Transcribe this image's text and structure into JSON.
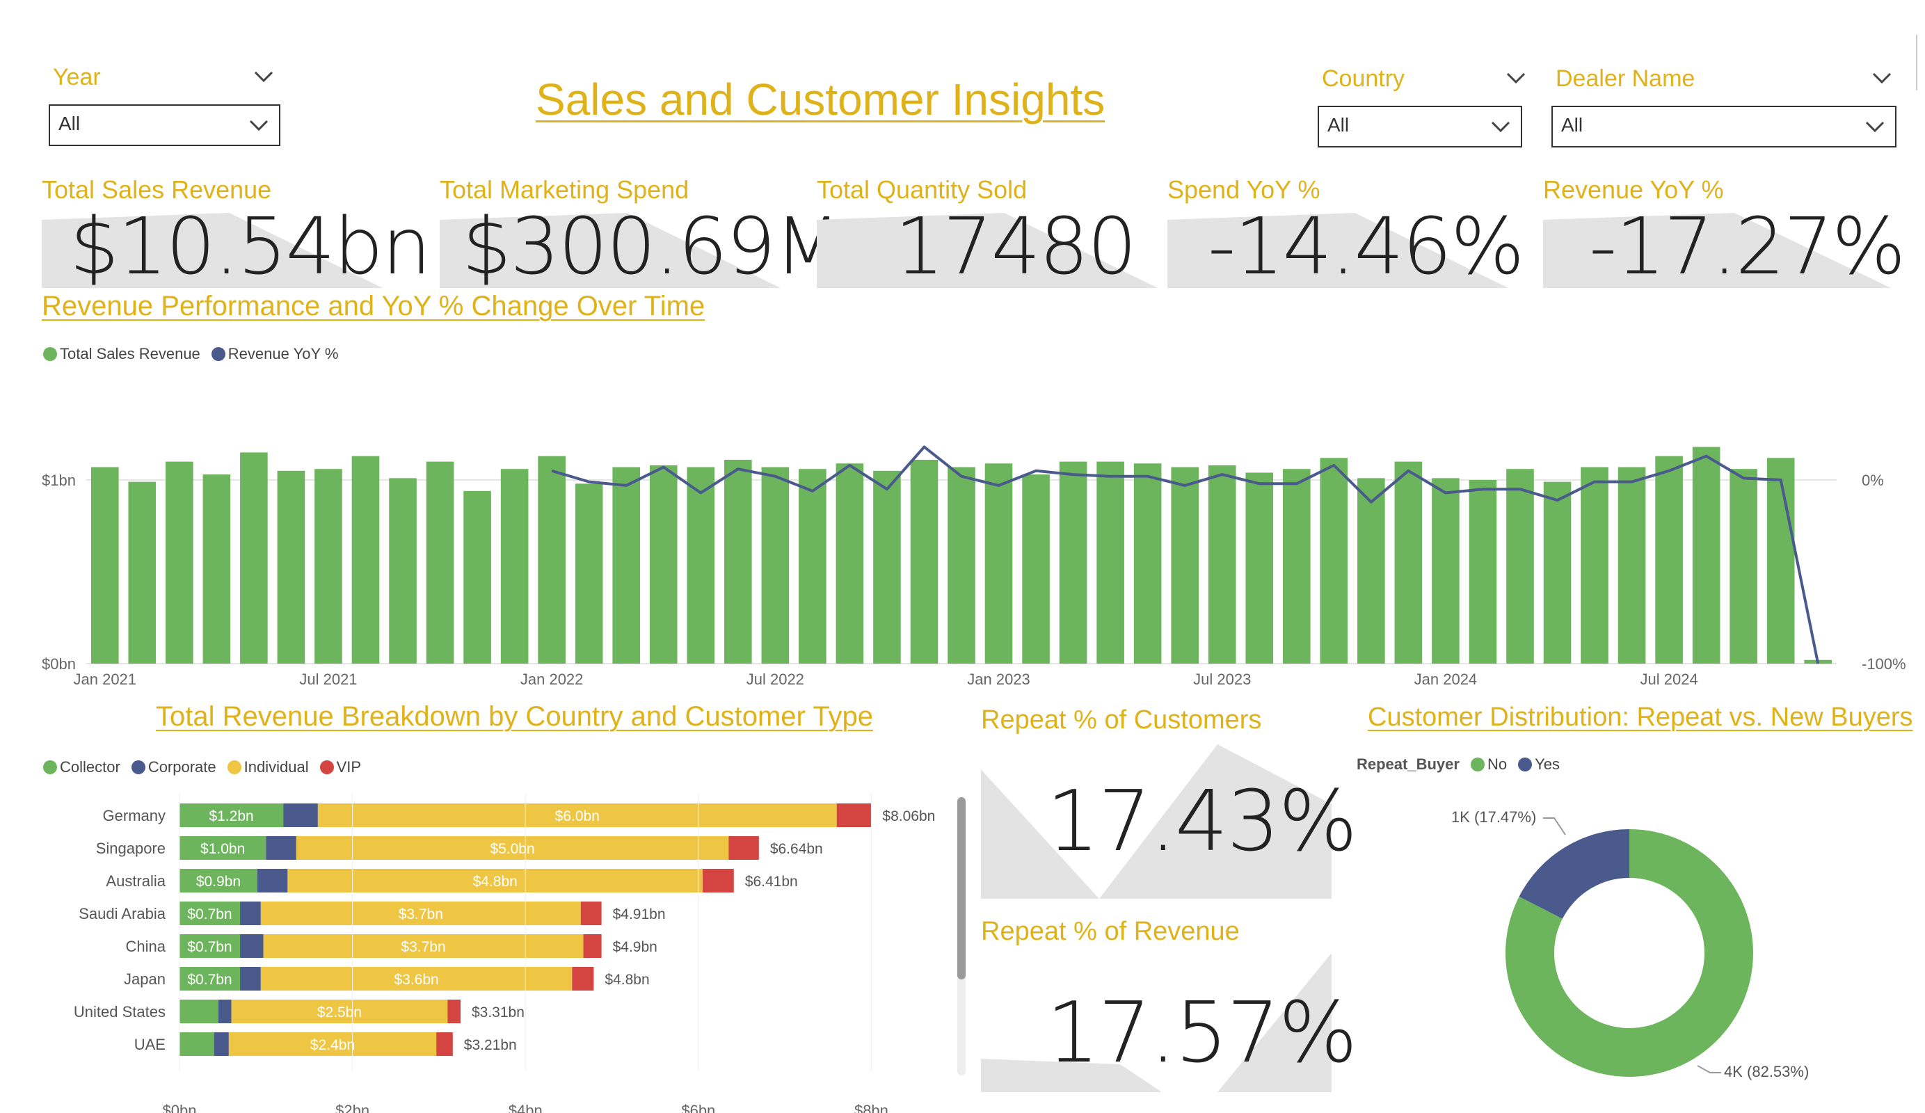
{
  "report": {
    "title": "Sales and Customer Insights"
  },
  "slicers": {
    "year": {
      "label": "Year",
      "value": "All"
    },
    "country": {
      "label": "Country",
      "value": "All"
    },
    "dealer": {
      "label": "Dealer Name",
      "value": "All"
    }
  },
  "kpis": [
    {
      "label": "Total Sales Revenue",
      "value": "$10.54bn"
    },
    {
      "label": "Total Marketing Spend",
      "value": "$300.69M"
    },
    {
      "label": "Total Quantity Sold",
      "value": "17480"
    },
    {
      "label": "Spend YoY %",
      "value": "-14.46%"
    },
    {
      "label": "Revenue YoY %",
      "value": "-17.27%"
    }
  ],
  "colors": {
    "accent": "#E0B21A",
    "collector": "#6DB55C",
    "corporate": "#4A5A8C",
    "individual": "#EEC643",
    "vip": "#D44542",
    "kpi_bg": "#E3E3E3"
  },
  "chart_data": [
    {
      "type": "bar",
      "title": "Revenue Performance and YoY % Change Over Time",
      "legend": [
        "Total Sales Revenue",
        "Revenue YoY %"
      ],
      "legend_position": "top-left",
      "x_tick_labels": [
        "Jan 2021",
        "Jul 2021",
        "Jan 2022",
        "Jul 2022",
        "Jan 2023",
        "Jul 2023",
        "Jan 2024",
        "Jul 2024"
      ],
      "y_left_ticks": [
        "$1bn",
        "$0bn"
      ],
      "y_right_ticks": [
        "0%",
        "-100%"
      ],
      "x": [
        "Jan 2021",
        "Feb 2021",
        "Mar 2021",
        "Apr 2021",
        "May 2021",
        "Jun 2021",
        "Jul 2021",
        "Aug 2021",
        "Sep 2021",
        "Oct 2021",
        "Nov 2021",
        "Dec 2021",
        "Jan 2022",
        "Feb 2022",
        "Mar 2022",
        "Apr 2022",
        "May 2022",
        "Jun 2022",
        "Jul 2022",
        "Aug 2022",
        "Sep 2022",
        "Oct 2022",
        "Nov 2022",
        "Dec 2022",
        "Jan 2023",
        "Feb 2023",
        "Mar 2023",
        "Apr 2023",
        "May 2023",
        "Jun 2023",
        "Jul 2023",
        "Aug 2023",
        "Sep 2023",
        "Oct 2023",
        "Nov 2023",
        "Dec 2023",
        "Jan 2024",
        "Feb 2024",
        "Mar 2024",
        "Apr 2024",
        "May 2024",
        "Jun 2024",
        "Jul 2024",
        "Aug 2024",
        "Sep 2024",
        "Oct 2024",
        "Nov 2024"
      ],
      "series": [
        {
          "name": "Total Sales Revenue",
          "axis": "left",
          "values": [
            1.07,
            0.99,
            1.1,
            1.03,
            1.15,
            1.05,
            1.06,
            1.13,
            1.01,
            1.1,
            0.94,
            1.06,
            1.13,
            0.98,
            1.07,
            1.08,
            1.07,
            1.11,
            1.07,
            1.06,
            1.09,
            1.05,
            1.11,
            1.07,
            1.09,
            1.03,
            1.1,
            1.1,
            1.09,
            1.07,
            1.08,
            1.04,
            1.06,
            1.12,
            1.01,
            1.1,
            1.01,
            1.0,
            1.06,
            0.99,
            1.07,
            1.07,
            1.13,
            1.18,
            1.06,
            1.12,
            0.02
          ]
        },
        {
          "name": "Revenue YoY %",
          "axis": "right",
          "values": [
            null,
            null,
            null,
            null,
            null,
            null,
            null,
            null,
            null,
            null,
            null,
            null,
            5,
            -1,
            -3,
            7,
            -7,
            6,
            2,
            -6,
            8,
            -5,
            18,
            2,
            -3,
            5,
            3,
            2,
            2,
            -3,
            3,
            -2,
            -2,
            8,
            -12,
            5,
            -7,
            -5,
            -5,
            -11,
            -1,
            -1,
            5,
            13,
            1,
            0,
            -100
          ]
        }
      ],
      "ylim_left": [
        0,
        1.2
      ],
      "ylim_right": [
        -100,
        20
      ]
    },
    {
      "type": "bar",
      "orientation": "horizontal",
      "stacked": true,
      "title": "Total Revenue Breakdown by Country and Customer Type",
      "legend": [
        "Collector",
        "Corporate",
        "Individual",
        "VIP"
      ],
      "legend_position": "top-left",
      "categories": [
        "Germany",
        "Singapore",
        "Australia",
        "Saudi Arabia",
        "China",
        "Japan",
        "United States",
        "UAE"
      ],
      "series": [
        {
          "name": "Collector",
          "values": [
            1.2,
            1.0,
            0.9,
            0.7,
            0.7,
            0.7,
            0.45,
            0.4
          ],
          "labels": [
            "$1.2bn",
            "$1.0bn",
            "$0.9bn",
            "$0.7bn",
            "$0.7bn",
            "$0.7bn",
            "",
            ""
          ]
        },
        {
          "name": "Corporate",
          "values": [
            0.4,
            0.35,
            0.35,
            0.24,
            0.27,
            0.24,
            0.15,
            0.17
          ],
          "labels": [
            "",
            "",
            "",
            "",
            "",
            "",
            "",
            ""
          ]
        },
        {
          "name": "Individual",
          "values": [
            6.0,
            5.0,
            4.8,
            3.7,
            3.7,
            3.6,
            2.5,
            2.4
          ],
          "labels": [
            "$6.0bn",
            "$5.0bn",
            "$4.8bn",
            "$3.7bn",
            "$3.7bn",
            "$3.6bn",
            "$2.5bn",
            "$2.4bn"
          ]
        },
        {
          "name": "VIP",
          "values": [
            0.4,
            0.35,
            0.36,
            0.24,
            0.21,
            0.25,
            0.15,
            0.19
          ],
          "labels": [
            "",
            "",
            "",
            "",
            "",
            "",
            "",
            ""
          ]
        }
      ],
      "totals": [
        "$8.06bn",
        "$6.64bn",
        "$6.41bn",
        "$4.91bn",
        "$4.9bn",
        "$4.8bn",
        "$3.31bn",
        "$3.21bn"
      ],
      "x_tick_labels": [
        "$0bn",
        "$2bn",
        "$4bn",
        "$6bn",
        "$8bn"
      ],
      "xlim": [
        0,
        8.3
      ]
    },
    {
      "type": "pie",
      "donut": true,
      "title": "Customer Distribution: Repeat vs. New Buyers",
      "legend_title": "Repeat_Buyer",
      "legend": [
        "No",
        "Yes"
      ],
      "legend_position": "top-left",
      "slices": [
        {
          "name": "No",
          "value": 82.53,
          "label": "4K (82.53%)"
        },
        {
          "name": "Yes",
          "value": 17.47,
          "label": "1K (17.47%)"
        }
      ]
    }
  ],
  "repeat_cards": [
    {
      "label": "Repeat % of Customers",
      "value": "17.43%"
    },
    {
      "label": "Repeat % of Revenue",
      "value": "17.57%"
    }
  ]
}
